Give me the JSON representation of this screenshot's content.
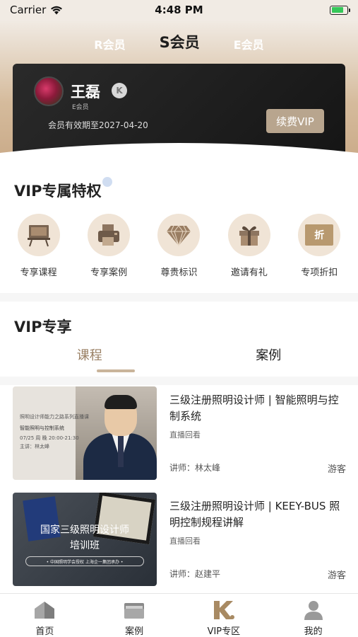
{
  "status_bar": {
    "carrier": "Carrier",
    "time": "4:48 PM",
    "battery_level": 0.8
  },
  "tiers": [
    {
      "label": "R会员"
    },
    {
      "label": "S会员"
    },
    {
      "label": "E会员"
    }
  ],
  "member_card": {
    "name": "王磊",
    "badge": "K",
    "level": "E会员",
    "expire_text": "会员有效期至2027-04-20",
    "renew_label": "续费VIP"
  },
  "privileges": {
    "title": "VIP专属特权",
    "items": [
      {
        "label": "专享课程",
        "icon": "blackboard-icon"
      },
      {
        "label": "专享案例",
        "icon": "printer-icon"
      },
      {
        "label": "尊贵标识",
        "icon": "diamond-icon"
      },
      {
        "label": "邀请有礼",
        "icon": "gift-icon"
      },
      {
        "label": "专项折扣",
        "icon": "discount-icon",
        "icon_text": "折"
      }
    ]
  },
  "vip_share": {
    "title": "VIP专享",
    "tabs": [
      {
        "label": "课程"
      },
      {
        "label": "案例"
      }
    ],
    "courses": [
      {
        "title": "三级注册照明设计师 | 智能照明与控制系统",
        "subtitle": "直播回看",
        "teacher": "讲师：林太峰",
        "tag": "游客",
        "thumb_lines": [
          "照明设计师能力之路系列直播课",
          "智能照明与控制系统",
          "07/25 周 晚 20:00-21:30",
          "主讲：林太峰"
        ]
      },
      {
        "title": "三级注册照明设计师 | KEEY-BUS 照明控制规程讲解",
        "subtitle": "直播回看",
        "teacher": "讲师：赵建平",
        "tag": "游客",
        "thumb_line1": "国家三级照明设计师",
        "thumb_line2": "培训班",
        "thumb_line3": "• 中国照明学会授权  上海企一集团承办 •"
      }
    ]
  },
  "tab_bar": [
    {
      "label": "首页",
      "icon": "home-icon"
    },
    {
      "label": "案例",
      "icon": "folder-icon"
    },
    {
      "label": "VIP专区",
      "icon": "vip-logo-icon"
    },
    {
      "label": "我的",
      "icon": "profile-icon"
    }
  ],
  "colors": {
    "accent": "#9a8064",
    "gold": "#c9b49a",
    "card_dark": "#1a1a1a"
  }
}
